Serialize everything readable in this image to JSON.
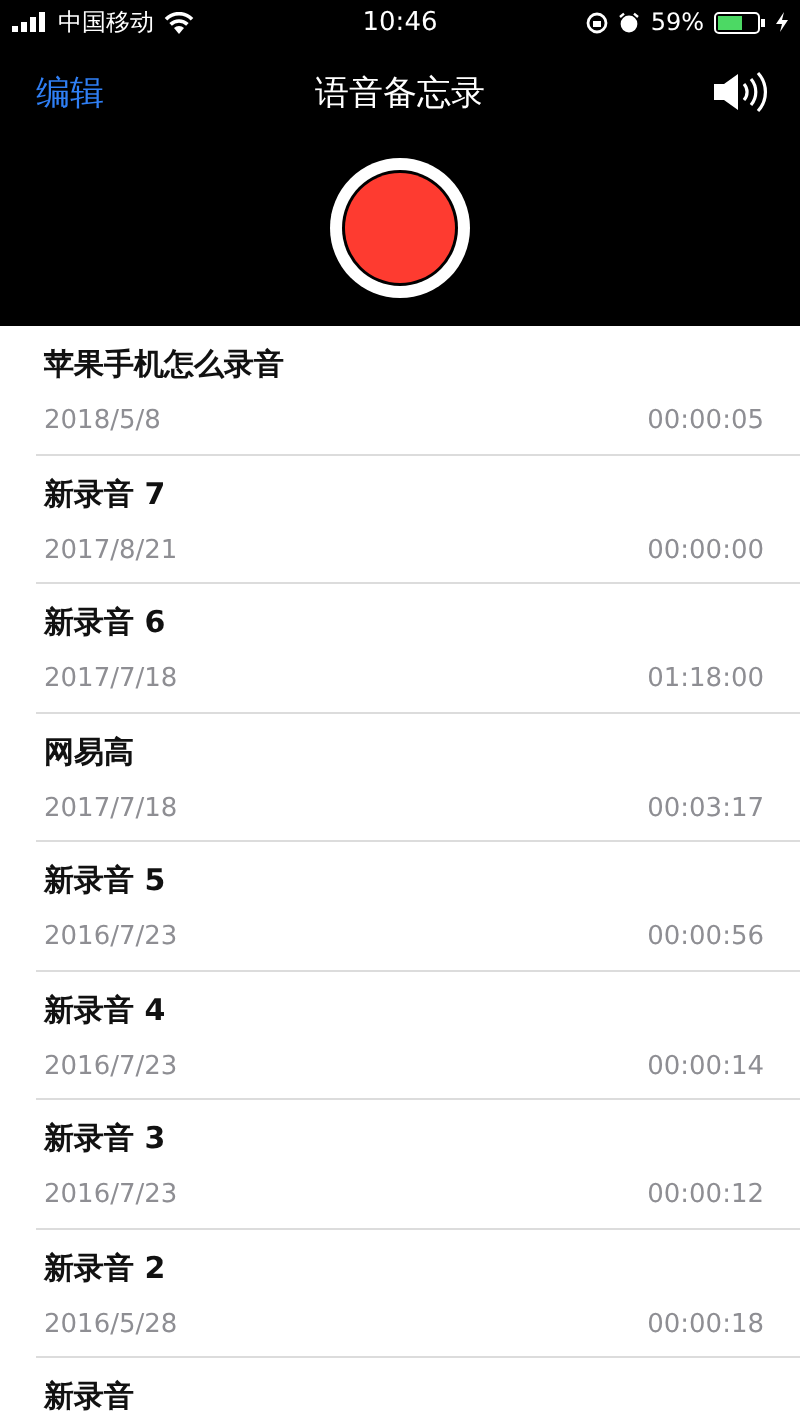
{
  "status_bar": {
    "carrier": "中国移动",
    "time": "10:46",
    "battery_text": "59%"
  },
  "nav": {
    "edit": "编辑",
    "title": "语音备忘录"
  },
  "recordings": [
    {
      "title": "苹果手机怎么录音",
      "date": "2018/5/8",
      "duration": "00:00:05"
    },
    {
      "title": "新录音 7",
      "date": "2017/8/21",
      "duration": "00:00:00"
    },
    {
      "title": "新录音 6",
      "date": "2017/7/18",
      "duration": "01:18:00"
    },
    {
      "title": "网易高",
      "date": "2017/7/18",
      "duration": "00:03:17"
    },
    {
      "title": "新录音 5",
      "date": "2016/7/23",
      "duration": "00:00:56"
    },
    {
      "title": "新录音 4",
      "date": "2016/7/23",
      "duration": "00:00:14"
    },
    {
      "title": "新录音 3",
      "date": "2016/7/23",
      "duration": "00:00:12"
    },
    {
      "title": "新录音 2",
      "date": "2016/5/28",
      "duration": "00:00:18"
    },
    {
      "title": "新录音"
    }
  ]
}
